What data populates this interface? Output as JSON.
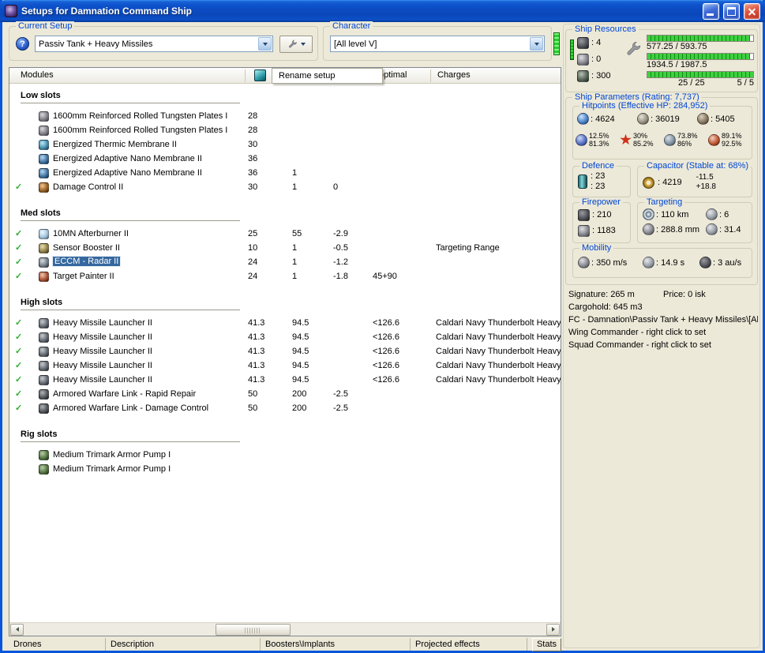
{
  "icons": {
    "check": "✓"
  },
  "window": {
    "title": "Setups for Damnation Command Ship"
  },
  "toolbar": {
    "current_setup_label": "Current Setup",
    "current_setup_value": "Passiv Tank + Heavy Missiles",
    "character_label": "Character",
    "character_value": "[All level V]",
    "help_glyph": "?"
  },
  "list": {
    "headers": {
      "modules": "Modules",
      "optimal": "optimal",
      "charges": "Charges"
    },
    "menu_rename": "Rename setup",
    "sections": [
      {
        "title": "Low slots",
        "rows": [
          {
            "icon": "armor-plate",
            "name": "1600mm Reinforced Rolled Tungsten Plates I",
            "c1": "28"
          },
          {
            "icon": "armor-plate",
            "name": "1600mm Reinforced Rolled Tungsten Plates I",
            "c1": "28"
          },
          {
            "icon": "thermic-membrane",
            "name": "Energized Thermic Membrane II",
            "c1": "30"
          },
          {
            "icon": "adaptive-membrane",
            "name": "Energized Adaptive Nano Membrane II",
            "c1": "36"
          },
          {
            "icon": "adaptive-membrane",
            "name": "Energized Adaptive Nano Membrane II",
            "c1": "36",
            "c2": "1"
          },
          {
            "checked": true,
            "icon": "damage-control",
            "name": "Damage Control II",
            "c1": "30",
            "c2": "1",
            "c3": "0"
          }
        ]
      },
      {
        "title": "Med slots",
        "rows": [
          {
            "checked": true,
            "icon": "afterburner",
            "name": "10MN Afterburner II",
            "c1": "25",
            "c2": "55",
            "c3": "-2.9"
          },
          {
            "checked": true,
            "icon": "sensor-booster",
            "name": "Sensor Booster II",
            "c1": "10",
            "c2": "1",
            "c3": "-0.5",
            "c5": "Targeting Range"
          },
          {
            "checked": true,
            "icon": "eccm",
            "name": "ECCM - Radar II",
            "selected": true,
            "c1": "24",
            "c2": "1",
            "c3": "-1.2"
          },
          {
            "checked": true,
            "icon": "target-painter",
            "name": "Target Painter II",
            "c1": "24",
            "c2": "1",
            "c3": "-1.8",
            "c4": "45+90"
          }
        ]
      },
      {
        "title": "High slots",
        "rows": [
          {
            "checked": true,
            "icon": "missile-launcher",
            "name": "Heavy Missile Launcher II",
            "c1": "41.3",
            "c2": "94.5",
            "c4": "<126.6",
            "c5": "Caldari Navy Thunderbolt Heavy M"
          },
          {
            "checked": true,
            "icon": "missile-launcher",
            "name": "Heavy Missile Launcher II",
            "c1": "41.3",
            "c2": "94.5",
            "c4": "<126.6",
            "c5": "Caldari Navy Thunderbolt Heavy M"
          },
          {
            "checked": true,
            "icon": "missile-launcher",
            "name": "Heavy Missile Launcher II",
            "c1": "41.3",
            "c2": "94.5",
            "c4": "<126.6",
            "c5": "Caldari Navy Thunderbolt Heavy M"
          },
          {
            "checked": true,
            "icon": "missile-launcher",
            "name": "Heavy Missile Launcher II",
            "c1": "41.3",
            "c2": "94.5",
            "c4": "<126.6",
            "c5": "Caldari Navy Thunderbolt Heavy M"
          },
          {
            "checked": true,
            "icon": "missile-launcher",
            "name": "Heavy Missile Launcher II",
            "c1": "41.3",
            "c2": "94.5",
            "c4": "<126.6",
            "c5": "Caldari Navy Thunderbolt Heavy M"
          },
          {
            "checked": true,
            "icon": "warfare-link",
            "name": "Armored Warfare Link - Rapid Repair",
            "c1": "50",
            "c2": "200",
            "c3": "-2.5"
          },
          {
            "checked": true,
            "icon": "warfare-link",
            "name": "Armored Warfare Link - Damage Control",
            "c1": "50",
            "c2": "200",
            "c3": "-2.5"
          }
        ]
      },
      {
        "title": "Rig slots",
        "rows": [
          {
            "icon": "armor-rig",
            "name": "Medium Trimark Armor Pump I"
          },
          {
            "icon": "armor-rig",
            "name": "Medium Trimark Armor Pump I"
          }
        ]
      }
    ]
  },
  "bottom_tabs": [
    "Drones",
    "Description",
    "Boosters\\Implants",
    "Projected effects",
    "Stats"
  ],
  "ship_resources": {
    "title": "Ship Resources",
    "slots": [
      {
        "name": "turret-hardpoints",
        "value": "4"
      },
      {
        "name": "launcher-hardpoints",
        "value": "0"
      },
      {
        "name": "calibration",
        "value": "300"
      }
    ],
    "bars": [
      {
        "name": "powergrid",
        "label": "577.25 / 593.75",
        "fill_pct": 97
      },
      {
        "name": "cpu",
        "label": "1934.5 / 1987.5",
        "fill_pct": 97
      },
      {
        "name": "slots",
        "label": "25 / 25",
        "label2": "5 / 5",
        "fill_pct": 100
      }
    ]
  },
  "ship_parameters": {
    "title": "Ship Parameters (Rating: 7,737)",
    "hitpoints": {
      "title": "Hitpoints (Effective HP: 284,952)",
      "shield": "4624",
      "armor": "36019",
      "structure": "5405",
      "resists": [
        {
          "name": "em",
          "top": "12.5%",
          "bottom": "81.3%"
        },
        {
          "name": "explosive",
          "top": "30%",
          "bottom": "85.2%"
        },
        {
          "name": "kinetic",
          "top": "73.8%",
          "bottom": "86%"
        },
        {
          "name": "thermal",
          "top": "89.1%",
          "bottom": "92.5%"
        }
      ]
    },
    "defence": {
      "title": "Defence",
      "value1": "23",
      "value2": "23"
    },
    "capacitor": {
      "title": "Capacitor (Stable at: 68%)",
      "amount": "4219",
      "drain": "-11.5",
      "recharge": "+18.8"
    },
    "firepower": {
      "title": "Firepower",
      "turret_dps": "210",
      "missile_dps": "1183"
    },
    "targeting": {
      "title": "Targeting",
      "range": "110 km",
      "max_targets": "6",
      "signature_resolution": "288.8 mm",
      "scan_resolution": "31.4"
    },
    "mobility": {
      "title": "Mobility",
      "speed": "350 m/s",
      "agility": "14.9 s",
      "warp_speed": "3 au/s"
    }
  },
  "footer": {
    "signature": "Signature: 265 m",
    "price": "Price: 0 isk",
    "cargohold": "Cargohold: 645 m3",
    "fleet_path": "FC - Damnation\\Passiv Tank + Heavy Missiles\\[Al",
    "wing_commander": "Wing Commander - right click to set",
    "squad_commander": "Squad Commander - right click to set"
  }
}
